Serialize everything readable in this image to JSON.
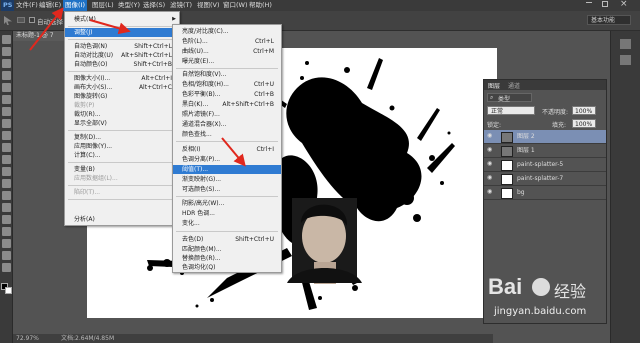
{
  "menubar": {
    "items": [
      "PS",
      "文件(F)",
      "编辑(E)",
      "图像(I)",
      "图层(L)",
      "类型(Y)",
      "选择(S)",
      "滤镜(T)",
      "视图(V)",
      "窗口(W)",
      "帮助(H)"
    ]
  },
  "options": {
    "auto_select": "自动选择",
    "workspace": "基本功能"
  },
  "document": {
    "tab": "未标题-1 @ 7",
    "zoom": "72.97%",
    "doc_info": "文档:2.64M/4.85M"
  },
  "image_menu": {
    "items": [
      {
        "label": "模式(M)",
        "submenu": true
      },
      {
        "label": "调整(J)",
        "submenu": true,
        "highlight": true
      },
      {
        "label": "自动色调(N)",
        "shortcut": "Shift+Ctrl+L"
      },
      {
        "label": "自动对比度(U)",
        "shortcut": "Alt+Shift+Ctrl+L"
      },
      {
        "label": "自动颜色(O)",
        "shortcut": "Shift+Ctrl+B"
      },
      {
        "label": "图像大小(I)...",
        "shortcut": "Alt+Ctrl+I"
      },
      {
        "label": "画布大小(S)...",
        "shortcut": "Alt+Ctrl+C"
      },
      {
        "label": "图像旋转(G)",
        "submenu": true
      },
      {
        "label": "裁剪(P)",
        "disabled": true
      },
      {
        "label": "裁切(R)..."
      },
      {
        "label": "显示全部(V)"
      },
      {
        "label": "复制(D)..."
      },
      {
        "label": "应用图像(Y)..."
      },
      {
        "label": "计算(C)..."
      },
      {
        "label": "变量(B)",
        "submenu": true
      },
      {
        "label": "应用数据组(L)...",
        "disabled": true
      },
      {
        "label": "陷印(T)...",
        "disabled": true
      },
      {
        "label": "分析(A)",
        "submenu": true
      }
    ]
  },
  "adjust_menu": {
    "items": [
      {
        "label": "亮度/对比度(C)..."
      },
      {
        "label": "色阶(L)...",
        "shortcut": "Ctrl+L"
      },
      {
        "label": "曲线(U)...",
        "shortcut": "Ctrl+M"
      },
      {
        "label": "曝光度(E)..."
      },
      {
        "label": "自然饱和度(V)..."
      },
      {
        "label": "色相/饱和度(H)...",
        "shortcut": "Ctrl+U"
      },
      {
        "label": "色彩平衡(B)...",
        "shortcut": "Ctrl+B"
      },
      {
        "label": "黑白(K)...",
        "shortcut": "Alt+Shift+Ctrl+B"
      },
      {
        "label": "照片滤镜(F)..."
      },
      {
        "label": "通道混合器(X)..."
      },
      {
        "label": "颜色查找..."
      },
      {
        "label": "反相(I)",
        "shortcut": "Ctrl+I"
      },
      {
        "label": "色调分离(P)..."
      },
      {
        "label": "阈值(T)...",
        "highlight": true
      },
      {
        "label": "渐变映射(G)..."
      },
      {
        "label": "可选颜色(S)..."
      },
      {
        "label": "阴影/高光(W)..."
      },
      {
        "label": "HDR 色调..."
      },
      {
        "label": "变化..."
      },
      {
        "label": "去色(D)",
        "shortcut": "Shift+Ctrl+U"
      },
      {
        "label": "匹配颜色(M)..."
      },
      {
        "label": "替换颜色(R)..."
      },
      {
        "label": "色调均化(Q)"
      }
    ]
  },
  "layers_panel": {
    "tabs": [
      "图层",
      "通道"
    ],
    "filter": "类型",
    "blend_mode": "正常",
    "opacity_label": "不透明度:",
    "opacity_value": "100%",
    "lock_label": "锁定:",
    "fill_label": "填充:",
    "fill_value": "100%",
    "layers": [
      {
        "name": "图层 2",
        "selected": true
      },
      {
        "name": "图层 1"
      },
      {
        "name": "paint-splatter-5"
      },
      {
        "name": "paint-splatter-7"
      },
      {
        "name": "bg"
      }
    ]
  },
  "watermark": {
    "brand": "Bai",
    "brand_cn": "经验",
    "url": "jingyan.baidu.com"
  },
  "colors": {
    "menubar_bg": "#3a3a3a",
    "highlight": "#2f7bd2",
    "arrow_red": "#e0281e",
    "selected_layer": "#7b8fb4"
  }
}
